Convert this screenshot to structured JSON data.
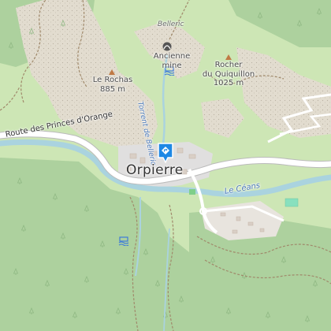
{
  "map": {
    "colors": {
      "forest": "#add19e",
      "meadow": "#cde6b5",
      "rock": "#e7e1d6",
      "river": "#aad3df",
      "road": "#ffffff",
      "residential": "#e0dfdf",
      "marker": "#1e88e5"
    },
    "labels": {
      "locality_north": "Belleric",
      "mine_line1": "Ancienne",
      "mine_line2": "mine",
      "peak_rochas_name": "Le Rochas",
      "peak_rochas_elev": "885 m",
      "peak_quiquillon_line1": "Rocher",
      "peak_quiquillon_line2": "du Quiquillon",
      "peak_quiquillon_elev": "1025 m",
      "stream": "Torrent de Belleric",
      "road": "Route des Princes d'Orange",
      "town": "Orpierre",
      "river": "Le Céans"
    },
    "icons": [
      "mine-icon",
      "peak-icon",
      "water-spring-icon",
      "location-marker-icon",
      "tree-icon"
    ]
  }
}
